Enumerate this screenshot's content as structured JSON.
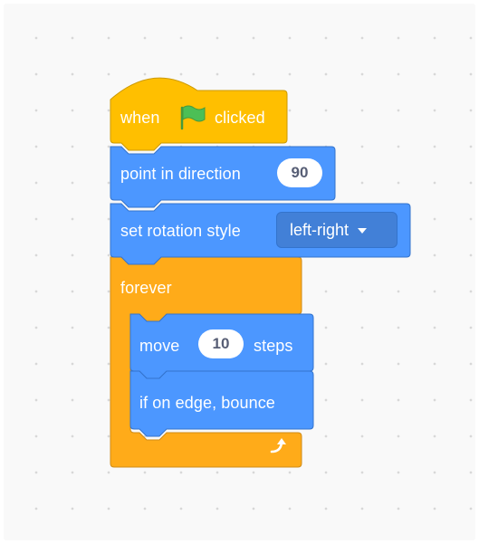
{
  "script": {
    "hat": {
      "label_when": "when",
      "flag_icon": "green-flag-icon",
      "label_clicked": "clicked"
    },
    "point_direction": {
      "label": "point in direction",
      "value": "90"
    },
    "rotation_style": {
      "label": "set rotation style",
      "selected": "left-right"
    },
    "forever": {
      "label": "forever",
      "loop_icon": "loop-arrow-icon"
    },
    "move": {
      "label_move": "move",
      "value": "10",
      "label_steps": "steps"
    },
    "bounce": {
      "label": "if on edge, bounce"
    }
  },
  "colors": {
    "events": "#ffbf00",
    "control": "#ffab19",
    "motion": "#4c97ff",
    "flag": "#4cbf56"
  }
}
